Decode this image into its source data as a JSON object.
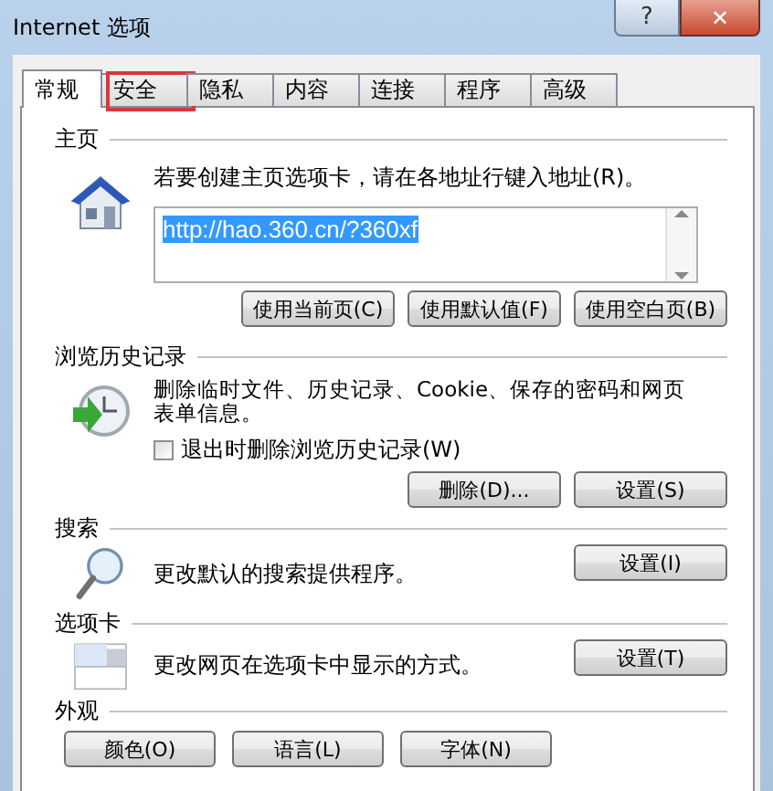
{
  "window": {
    "title": "Internet 选项",
    "help_button": "?",
    "close_button": "✕"
  },
  "tabs": [
    {
      "label": "常规",
      "selected": true,
      "highlighted": false
    },
    {
      "label": "安全",
      "selected": false,
      "highlighted": true
    },
    {
      "label": "隐私",
      "selected": false,
      "highlighted": false
    },
    {
      "label": "内容",
      "selected": false,
      "highlighted": false
    },
    {
      "label": "连接",
      "selected": false,
      "highlighted": false
    },
    {
      "label": "程序",
      "selected": false,
      "highlighted": false
    },
    {
      "label": "高级",
      "selected": false,
      "highlighted": false
    }
  ],
  "home_page": {
    "heading": "主页",
    "description": "若要创建主页选项卡，请在各地址行键入地址(R)。",
    "url": "http://hao.360.cn/?360xf",
    "url_selected": true,
    "buttons": [
      "使用当前页(C)",
      "使用默认值(F)",
      "使用空白页(B)"
    ]
  },
  "browsing_history": {
    "heading": "浏览历史记录",
    "description": "删除临时文件、历史记录、Cookie、保存的密码和网页表单信息。",
    "checkbox": {
      "label": "退出时删除浏览历史记录(W)",
      "checked": false
    },
    "buttons": [
      "删除(D)...",
      "设置(S)"
    ]
  },
  "search": {
    "heading": "搜索",
    "description": "更改默认的搜索提供程序。",
    "buttons": [
      "设置(I)"
    ]
  },
  "tabbed_browsing": {
    "heading": "选项卡",
    "description": "更改网页在选项卡中显示的方式。",
    "buttons": [
      "设置(T)"
    ]
  },
  "appearance": {
    "heading": "外观",
    "buttons": [
      "颜色(O)",
      "语言(L)",
      "字体(N)"
    ]
  }
}
